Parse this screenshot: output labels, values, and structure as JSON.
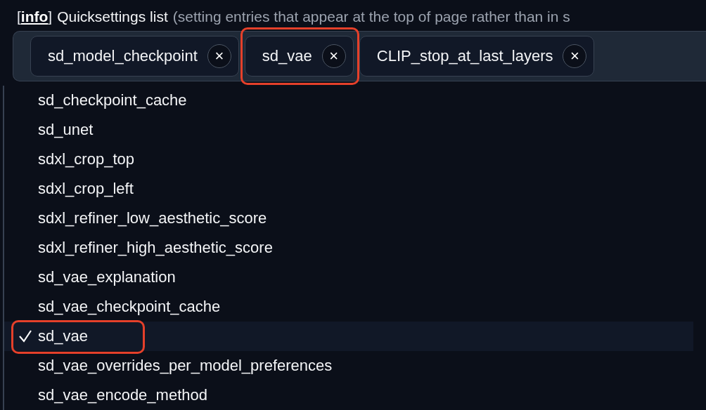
{
  "setting": {
    "open_bracket": "[",
    "info_tag": "info",
    "close_bracket": "]",
    "label": "Quicksettings list",
    "hint": "(setting entries that appear at the top of page rather than in s"
  },
  "chips": [
    {
      "label": "sd_model_checkpoint",
      "remove": "×",
      "annotated": false
    },
    {
      "label": "sd_vae",
      "remove": "×",
      "annotated": true
    },
    {
      "label": "CLIP_stop_at_last_layers",
      "remove": "×",
      "annotated": false
    }
  ],
  "options": [
    {
      "label": "sd_checkpoint_cache",
      "selected": false,
      "annotated": false
    },
    {
      "label": "sd_unet",
      "selected": false,
      "annotated": false
    },
    {
      "label": "sdxl_crop_top",
      "selected": false,
      "annotated": false
    },
    {
      "label": "sdxl_crop_left",
      "selected": false,
      "annotated": false
    },
    {
      "label": "sdxl_refiner_low_aesthetic_score",
      "selected": false,
      "annotated": false
    },
    {
      "label": "sdxl_refiner_high_aesthetic_score",
      "selected": false,
      "annotated": false
    },
    {
      "label": "sd_vae_explanation",
      "selected": false,
      "annotated": false
    },
    {
      "label": "sd_vae_checkpoint_cache",
      "selected": false,
      "annotated": false
    },
    {
      "label": "sd_vae",
      "selected": true,
      "annotated": true
    },
    {
      "label": "sd_vae_overrides_per_model_preferences",
      "selected": false,
      "annotated": false
    },
    {
      "label": "sd_vae_encode_method",
      "selected": false,
      "annotated": false
    }
  ]
}
